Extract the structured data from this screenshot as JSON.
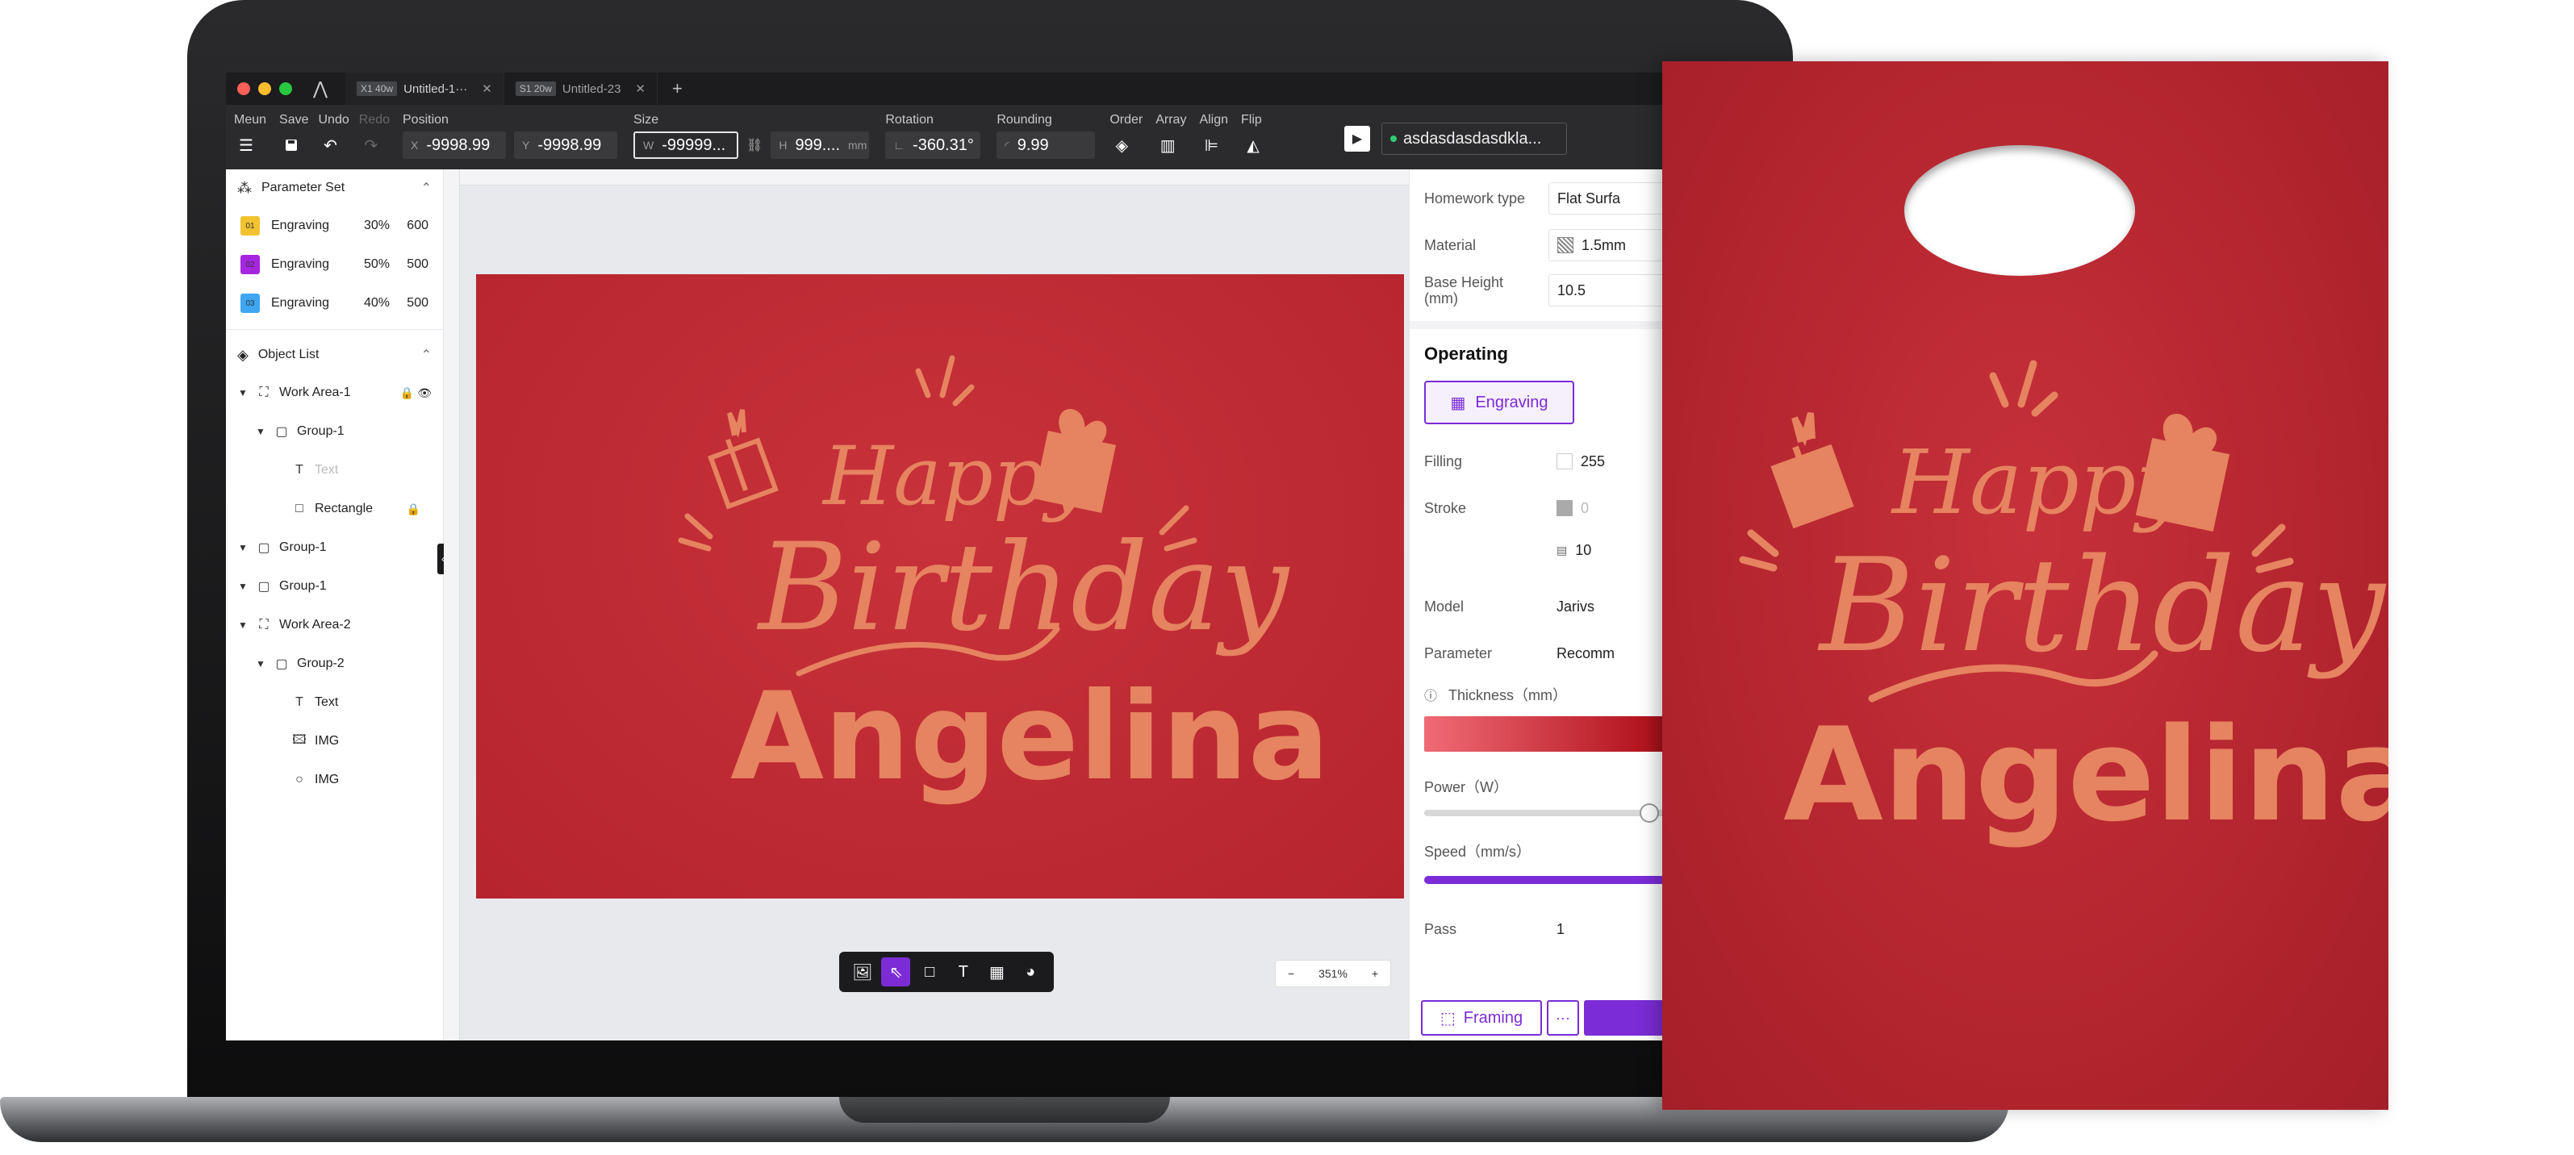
{
  "window": {
    "tabs": [
      {
        "tag": "X1 40w",
        "label": "Untitled-1···",
        "active": true
      },
      {
        "tag": "S1 20w",
        "label": "Untitled-23",
        "active": false
      }
    ],
    "new_tab": "+"
  },
  "toolbar": {
    "menu_label": "Meun",
    "save_label": "Save",
    "undo_label": "Undo",
    "redo_label": "Redo",
    "position_label": "Position",
    "x_prefix": "X",
    "x_value": "-9998.99",
    "y_prefix": "Y",
    "y_value": "-9998.99",
    "size_label": "Size",
    "w_prefix": "W",
    "w_value": "-99999...",
    "h_prefix": "H",
    "h_value": "999....",
    "size_unit": "mm",
    "rotation_label": "Rotation",
    "rotation_value": "-360.31°",
    "rounding_label": "Rounding",
    "rounding_value": "9.99",
    "order_label": "Order",
    "array_label": "Array",
    "align_label": "Align",
    "flip_label": "Flip",
    "device_name": "asdasdasdasdkla..."
  },
  "left_panel": {
    "parameter_set_title": "Parameter Set",
    "parameters": [
      {
        "id": "01",
        "name": "Engraving",
        "power": "30%",
        "speed": "600",
        "color": "#f2c230"
      },
      {
        "id": "02",
        "name": "Engraving",
        "power": "50%",
        "speed": "500",
        "color": "#a626e0"
      },
      {
        "id": "03",
        "name": "Engraving",
        "power": "40%",
        "speed": "500",
        "color": "#3ea6f2"
      }
    ],
    "object_list_title": "Object List",
    "objects": [
      {
        "label": "Work Area-1",
        "level": 0
      },
      {
        "label": "Group-1",
        "level": 1
      },
      {
        "label": "Text",
        "level": 2
      },
      {
        "label": "Rectangle",
        "level": 2
      },
      {
        "label": "Group-1",
        "level": 0
      },
      {
        "label": "Group-1",
        "level": 0
      },
      {
        "label": "Work Area-2",
        "level": 0
      },
      {
        "label": "Group-2",
        "level": 1
      },
      {
        "label": "Text",
        "level": 2
      },
      {
        "label": "IMG",
        "level": 2
      },
      {
        "label": "IMG",
        "level": 2
      }
    ]
  },
  "canvas": {
    "line1": "Happy",
    "line2": "Birthday",
    "line3": "Angelina",
    "zoom_value": "351%",
    "zoom_minus": "−",
    "zoom_plus": "+"
  },
  "right_panel": {
    "homework_type_label": "Homework type",
    "homework_type_value": "Flat Surfa",
    "material_label": "Material",
    "material_value": "1.5mm",
    "base_height_label": "Base Height (mm)",
    "base_height_value": "10.5",
    "operating_title": "Operating",
    "operating_mode": "Engraving",
    "filling_label": "Filling",
    "filling_value": "255",
    "stroke_label": "Stroke",
    "stroke_value": "0",
    "stroke_width_value": "10",
    "model_label": "Model",
    "model_value": "Jarivs",
    "parameter_label": "Parameter",
    "parameter_value": "Recomm",
    "thickness_label": "Thickness（mm）",
    "power_label": "Power（W）",
    "power_level": 0.82,
    "speed_label": "Speed（mm/s）",
    "pass_label": "Pass",
    "pass_value": "1",
    "framing_label": "Framing",
    "more_label": "···"
  },
  "product": {
    "line1": "Happy",
    "line2": "Birthday",
    "line3": "Angelina"
  },
  "colors": {
    "accent": "#7b2cd6",
    "card_red": "#b8262f",
    "etch": "#e68360"
  }
}
